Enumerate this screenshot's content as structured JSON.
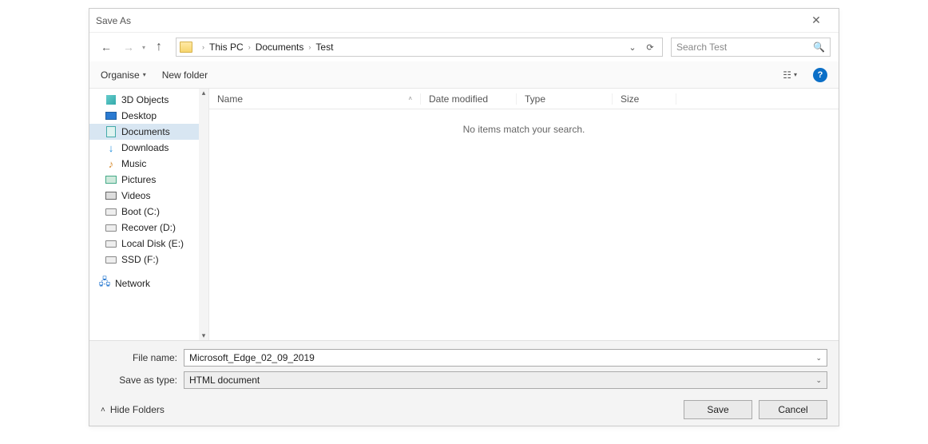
{
  "title": "Save As",
  "breadcrumbs": [
    "This PC",
    "Documents",
    "Test"
  ],
  "search": {
    "placeholder": "Search Test"
  },
  "toolbar": {
    "organise_label": "Organise",
    "newfolder_label": "New folder"
  },
  "columns": {
    "name": "Name",
    "date": "Date modified",
    "type": "Type",
    "size": "Size"
  },
  "empty_message": "No items match your search.",
  "tree": {
    "items": [
      {
        "label": "3D Objects",
        "icon": "cube"
      },
      {
        "label": "Desktop",
        "icon": "desktop"
      },
      {
        "label": "Documents",
        "icon": "doc",
        "selected": true
      },
      {
        "label": "Downloads",
        "icon": "down"
      },
      {
        "label": "Music",
        "icon": "music"
      },
      {
        "label": "Pictures",
        "icon": "pic"
      },
      {
        "label": "Videos",
        "icon": "vid"
      },
      {
        "label": "Boot (C:)",
        "icon": "drive"
      },
      {
        "label": "Recover (D:)",
        "icon": "drive"
      },
      {
        "label": "Local Disk (E:)",
        "icon": "drive"
      },
      {
        "label": "SSD (F:)",
        "icon": "drive"
      }
    ],
    "network_label": "Network"
  },
  "filename": {
    "label": "File name:",
    "value": "Microsoft_Edge_02_09_2019"
  },
  "filetype": {
    "label": "Save as type:",
    "value": "HTML document"
  },
  "footer": {
    "hide_folders": "Hide Folders",
    "save": "Save",
    "cancel": "Cancel"
  }
}
